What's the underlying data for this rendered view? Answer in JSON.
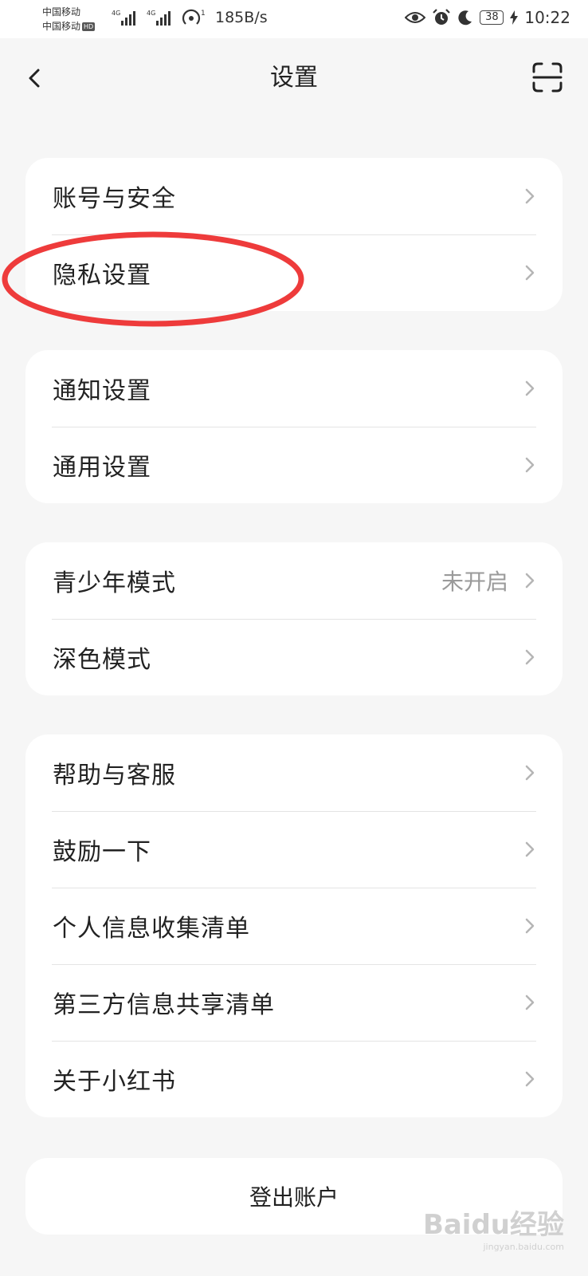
{
  "status_bar": {
    "carrier_1": "中国移动",
    "carrier_2": "中国移动",
    "hd_badge": "HD",
    "network_1": "4G",
    "network_2": "4G",
    "hotspot_count": "1",
    "net_speed": "185B/s",
    "battery_level": "38",
    "time": "10:22"
  },
  "header": {
    "title": "设置"
  },
  "groups": [
    {
      "items": [
        {
          "label": "账号与安全"
        },
        {
          "label": "隐私设置"
        }
      ]
    },
    {
      "items": [
        {
          "label": "通知设置"
        },
        {
          "label": "通用设置"
        }
      ]
    },
    {
      "items": [
        {
          "label": "青少年模式",
          "value": "未开启"
        },
        {
          "label": "深色模式"
        }
      ]
    },
    {
      "items": [
        {
          "label": "帮助与客服"
        },
        {
          "label": "鼓励一下"
        },
        {
          "label": "个人信息收集清单"
        },
        {
          "label": "第三方信息共享清单"
        },
        {
          "label": "关于小红书"
        }
      ]
    }
  ],
  "logout": {
    "label": "登出账户"
  },
  "annotation": {
    "color": "#ee3b3b"
  },
  "watermark": {
    "text": "Baidu经验",
    "subtext": "jingyan.baidu.com"
  }
}
